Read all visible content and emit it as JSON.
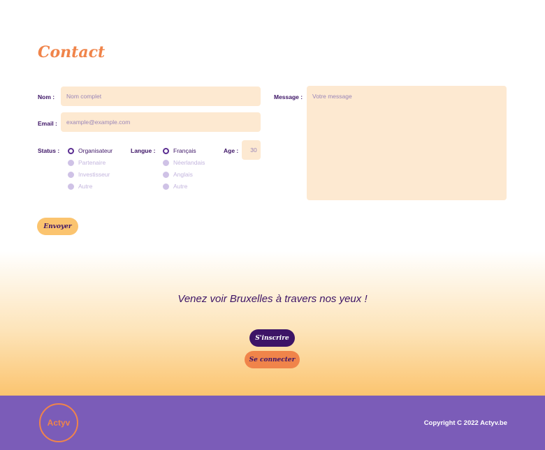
{
  "contact": {
    "title": "Contact",
    "name_label": "Nom :",
    "name_placeholder": "Nom complet",
    "email_label": "Email :",
    "email_placeholder": "example@example.com",
    "message_label": "Message :",
    "message_placeholder": "Votre message",
    "status_label": "Status :",
    "status_options": [
      "Organisateur",
      "Partenaire",
      "Investisseur",
      "Autre"
    ],
    "status_selected": "Organisateur",
    "language_label": "Langue :",
    "language_options": [
      "Français",
      "Néerlandais",
      "Anglais",
      "Autre"
    ],
    "language_selected": "Français",
    "age_label": "Age :",
    "age_placeholder": "30",
    "submit_label": "Envoyer"
  },
  "cta": {
    "tagline": "Venez voir Bruxelles à travers nos yeux !",
    "register_label": "S'inscrire",
    "login_label": "Se connecter"
  },
  "footer": {
    "logo_text": "Actyv",
    "copyright": "Copyright C 2022 Actyv.be"
  },
  "colors": {
    "accent_orange": "#f0844a",
    "button_yellow": "#fbc46f",
    "dark_purple": "#3d1466",
    "footer_purple": "#7b5cb8",
    "field_bg": "#fde9d1"
  }
}
